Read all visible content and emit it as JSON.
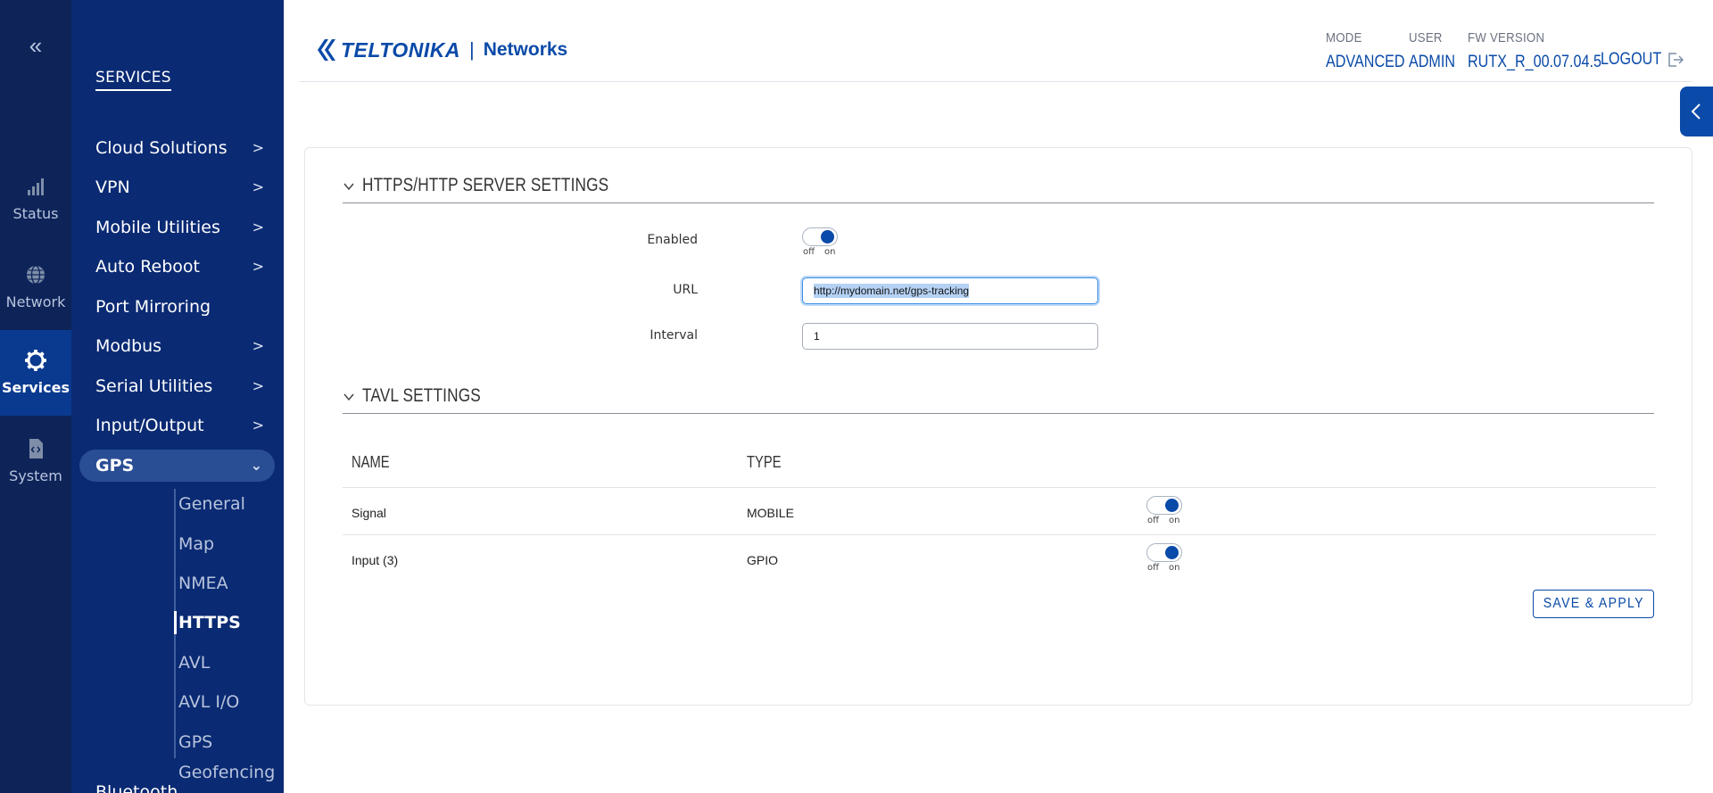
{
  "rail": {
    "items": [
      {
        "label": "Status",
        "icon": "signal-bars-icon"
      },
      {
        "label": "Network",
        "icon": "globe-icon"
      },
      {
        "label": "Services",
        "icon": "gear-icon"
      },
      {
        "label": "System",
        "icon": "code-file-icon"
      }
    ],
    "active": "Services"
  },
  "menu": {
    "title": "SERVICES",
    "items": [
      {
        "label": "Cloud Solutions",
        "has_children": true
      },
      {
        "label": "VPN",
        "has_children": true
      },
      {
        "label": "Mobile Utilities",
        "has_children": true
      },
      {
        "label": "Auto Reboot",
        "has_children": true
      },
      {
        "label": "Port Mirroring",
        "has_children": false
      },
      {
        "label": "Modbus",
        "has_children": true
      },
      {
        "label": "Serial Utilities",
        "has_children": true
      },
      {
        "label": "Input/Output",
        "has_children": true
      },
      {
        "label": "GPS",
        "has_children": true,
        "expanded": true
      },
      {
        "label": "Bluetooth",
        "has_children": false
      }
    ],
    "gps_submenu": [
      "General",
      "Map",
      "NMEA",
      "HTTPS",
      "AVL",
      "AVL I/O",
      "GPS Geofencing"
    ],
    "active_submenu": "HTTPS"
  },
  "header": {
    "brand": "TELTONIKA",
    "separator": "|",
    "product": "Networks",
    "mode_label": "MODE",
    "mode_value": "ADVANCED",
    "user_label": "USER",
    "user_value": "ADMIN",
    "fw_label": "FW VERSION",
    "fw_value": "RUTX_R_00.07.04.5",
    "logout_label": "LOGOUT"
  },
  "https_section": {
    "title": "HTTPS/HTTP SERVER SETTINGS",
    "enabled_label": "Enabled",
    "enabled": true,
    "toggle_off": "off",
    "toggle_on": "on",
    "url_label": "URL",
    "url_value": "http://mydomain.net/gps-tracking",
    "interval_label": "Interval",
    "interval_value": "1"
  },
  "tavl_section": {
    "title": "TAVL SETTINGS",
    "columns": [
      "NAME",
      "TYPE"
    ],
    "rows": [
      {
        "name": "Signal",
        "type": "MOBILE",
        "enabled": true
      },
      {
        "name": "Input (3)",
        "type": "GPIO",
        "enabled": true
      }
    ]
  },
  "actions": {
    "save_apply": "SAVE & APPLY"
  },
  "colors": {
    "accent": "#0a4aa8",
    "sidebar": "#0a2a73",
    "rail": "#0e2459"
  }
}
